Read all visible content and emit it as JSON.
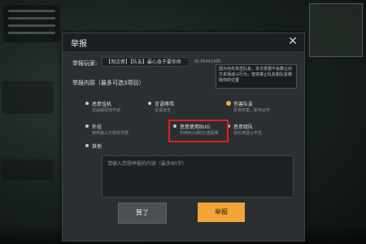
{
  "dialog": {
    "title": "举报",
    "close_symbol": "✕",
    "player_label": "举报玩家:",
    "player_name": "【淘沈者】【队友】最心急于要你命",
    "player_id": "ID:36441935",
    "content_label": "举报内容（最多可选3项目）",
    "tooltip": "因为你先攻击队友，本次举报不会算让对方本场战斗行为，但将禁止队友和队友移除你的位置",
    "options": [
      {
        "name": "恶意挂机",
        "desc": "非战或原地不动"
      },
      {
        "name": "言语辱骂",
        "desc": "言语攻击"
      },
      {
        "name": "伤害队友",
        "desc": "恶意伤害，影响合作"
      },
      {
        "name": "外挂",
        "desc": "使用第三方软件作弊"
      },
      {
        "name": "恶意使用BUG",
        "desc": "利用BUG刷分/透视等"
      },
      {
        "name": "恶意组队",
        "desc": "违反竞技公平性"
      },
      {
        "name": "其他",
        "desc": ""
      }
    ],
    "textarea_placeholder": "请输入您想举报的内容（最多80字）",
    "cancel_label": "算了",
    "report_label": "举报"
  }
}
